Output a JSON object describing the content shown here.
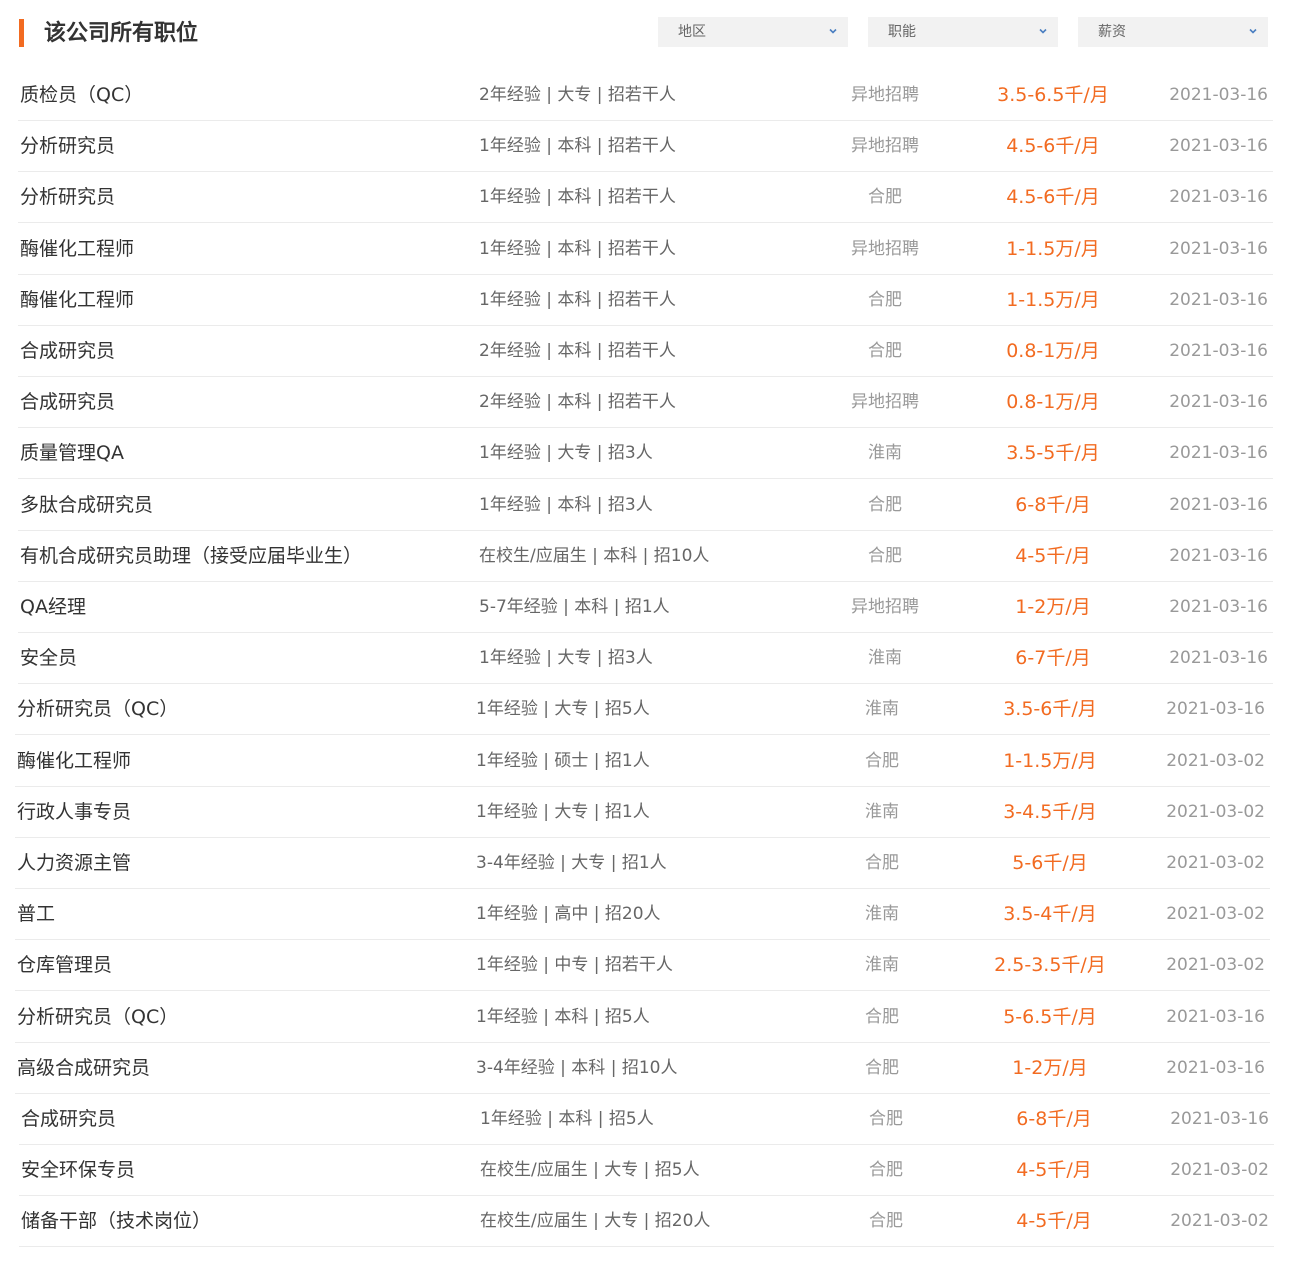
{
  "header": {
    "title": "该公司所有职位",
    "filters": [
      {
        "label": "地区",
        "icon": "chevron-down-icon"
      },
      {
        "label": "职能",
        "icon": "chevron-down-icon"
      },
      {
        "label": "薪资",
        "icon": "chevron-down-icon"
      }
    ]
  },
  "colors": {
    "accent": "#f26b21",
    "salary": "#f26b21",
    "divider": "#ebebeb",
    "filter_bg": "#f2f2f2"
  },
  "jobs": [
    {
      "title": "质检员（QC）",
      "requirements": "2年经验 | 大专 | 招若干人",
      "location": "异地招聘",
      "salary": "3.5-6.5千/月",
      "date": "2021-03-16"
    },
    {
      "title": "分析研究员",
      "requirements": "1年经验 | 本科 | 招若干人",
      "location": "异地招聘",
      "salary": "4.5-6千/月",
      "date": "2021-03-16"
    },
    {
      "title": "分析研究员",
      "requirements": "1年经验 | 本科 | 招若干人",
      "location": "合肥",
      "salary": "4.5-6千/月",
      "date": "2021-03-16"
    },
    {
      "title": "酶催化工程师",
      "requirements": "1年经验 | 本科 | 招若干人",
      "location": "异地招聘",
      "salary": "1-1.5万/月",
      "date": "2021-03-16"
    },
    {
      "title": "酶催化工程师",
      "requirements": "1年经验 | 本科 | 招若干人",
      "location": "合肥",
      "salary": "1-1.5万/月",
      "date": "2021-03-16"
    },
    {
      "title": "合成研究员",
      "requirements": "2年经验 | 本科 | 招若干人",
      "location": "合肥",
      "salary": "0.8-1万/月",
      "date": "2021-03-16"
    },
    {
      "title": "合成研究员",
      "requirements": "2年经验 | 本科 | 招若干人",
      "location": "异地招聘",
      "salary": "0.8-1万/月",
      "date": "2021-03-16"
    },
    {
      "title": "质量管理QA",
      "requirements": "1年经验 | 大专 | 招3人",
      "location": "淮南",
      "salary": "3.5-5千/月",
      "date": "2021-03-16"
    },
    {
      "title": "多肽合成研究员",
      "requirements": "1年经验 | 本科 | 招3人",
      "location": "合肥",
      "salary": "6-8千/月",
      "date": "2021-03-16"
    },
    {
      "title": "有机合成研究员助理（接受应届毕业生）",
      "requirements": "在校生/应届生 | 本科 | 招10人",
      "location": "合肥",
      "salary": "4-5千/月",
      "date": "2021-03-16"
    },
    {
      "title": "QA经理",
      "requirements": "5-7年经验 | 本科 | 招1人",
      "location": "异地招聘",
      "salary": "1-2万/月",
      "date": "2021-03-16"
    },
    {
      "title": "安全员",
      "requirements": "1年经验 | 大专 | 招3人",
      "location": "淮南",
      "salary": "6-7千/月",
      "date": "2021-03-16"
    },
    {
      "title": "分析研究员（QC）",
      "requirements": "1年经验 | 大专 | 招5人",
      "location": "淮南",
      "salary": "3.5-6千/月",
      "date": "2021-03-16"
    },
    {
      "title": "酶催化工程师",
      "requirements": "1年经验 | 硕士 | 招1人",
      "location": "合肥",
      "salary": "1-1.5万/月",
      "date": "2021-03-02"
    },
    {
      "title": "行政人事专员",
      "requirements": "1年经验 | 大专 | 招1人",
      "location": "淮南",
      "salary": "3-4.5千/月",
      "date": "2021-03-02"
    },
    {
      "title": "人力资源主管",
      "requirements": "3-4年经验 | 大专 | 招1人",
      "location": "合肥",
      "salary": "5-6千/月",
      "date": "2021-03-02"
    },
    {
      "title": "普工",
      "requirements": "1年经验 | 高中 | 招20人",
      "location": "淮南",
      "salary": "3.5-4千/月",
      "date": "2021-03-02"
    },
    {
      "title": "仓库管理员",
      "requirements": "1年经验 | 中专 | 招若干人",
      "location": "淮南",
      "salary": "2.5-3.5千/月",
      "date": "2021-03-02"
    },
    {
      "title": "分析研究员（QC）",
      "requirements": "1年经验 | 本科 | 招5人",
      "location": "合肥",
      "salary": "5-6.5千/月",
      "date": "2021-03-16"
    },
    {
      "title": "高级合成研究员",
      "requirements": "3-4年经验 | 本科 | 招10人",
      "location": "合肥",
      "salary": "1-2万/月",
      "date": "2021-03-16"
    },
    {
      "title": "合成研究员",
      "requirements": "1年经验 | 本科 | 招5人",
      "location": "合肥",
      "salary": "6-8千/月",
      "date": "2021-03-16"
    },
    {
      "title": "安全环保专员",
      "requirements": "在校生/应届生 | 大专 | 招5人",
      "location": "合肥",
      "salary": "4-5千/月",
      "date": "2021-03-02"
    },
    {
      "title": "储备干部（技术岗位）",
      "requirements": "在校生/应届生 | 大专 | 招20人",
      "location": "合肥",
      "salary": "4-5千/月",
      "date": "2021-03-02"
    }
  ]
}
